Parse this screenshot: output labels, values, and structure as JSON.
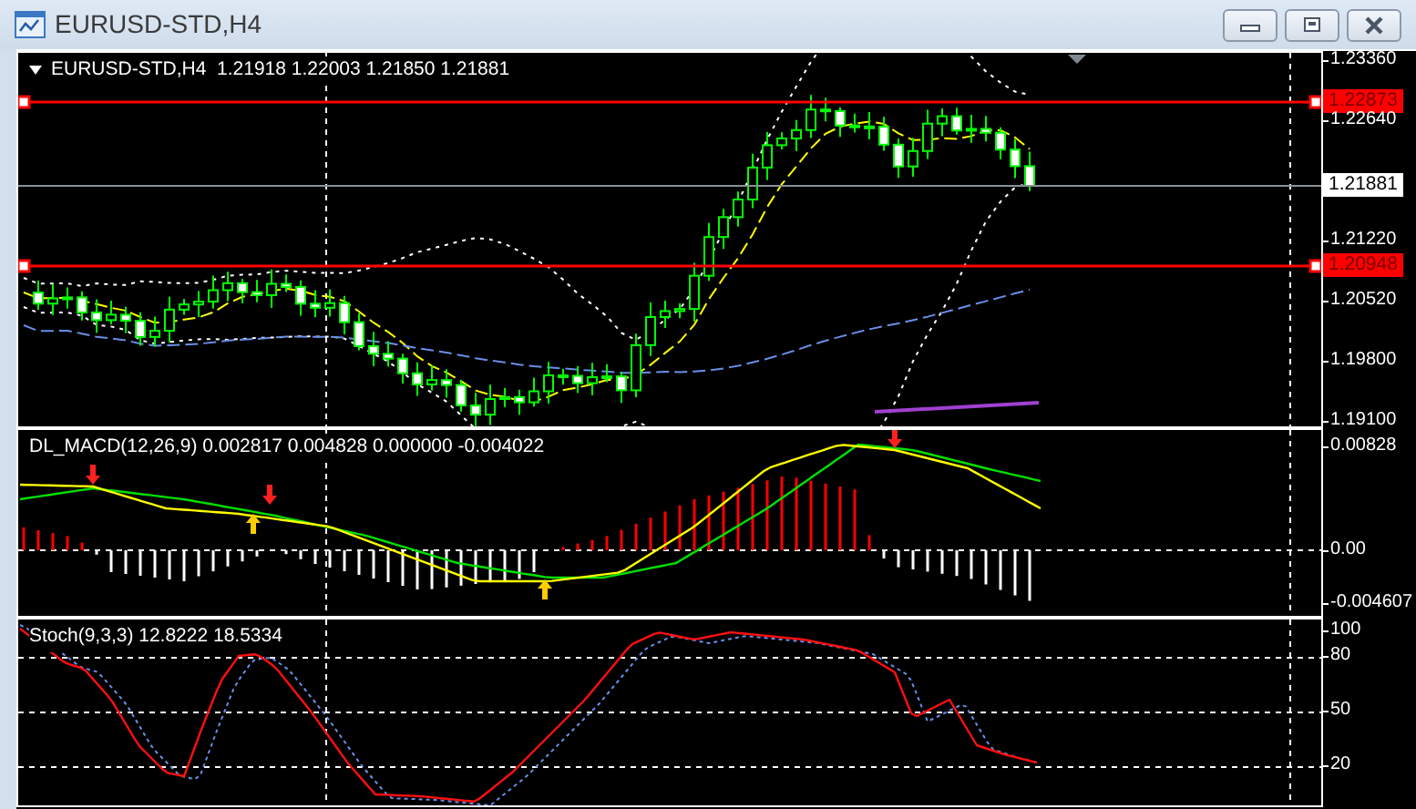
{
  "window": {
    "title": "EURUSD-STD,H4",
    "buttons": [
      {
        "kind": "minimize"
      },
      {
        "kind": "restore"
      },
      {
        "kind": "close"
      }
    ]
  },
  "price_pane": {
    "legend": "EURUSD-STD,H4  1.21918 1.22003 1.21850 1.21881",
    "axis_labels": [
      "1.23360",
      "1.22640",
      "1.21220",
      "1.20520",
      "1.19800",
      "1.19100"
    ],
    "lines": [
      {
        "kind": "level",
        "label": "1.22873"
      },
      {
        "kind": "bid",
        "label": "1.21881"
      },
      {
        "kind": "level",
        "label": "1.20948"
      }
    ]
  },
  "macd_pane": {
    "legend": "DL_MACD(12,26,9) 0.002817 0.004828 0.000000 -0.004022",
    "axis_labels": [
      "0.00828",
      "0.00",
      "-0.004607"
    ]
  },
  "stoch_pane": {
    "legend": "Stoch(9,3,3) 12.8222 18.5334",
    "axis_labels": [
      "100",
      "80",
      "50",
      "20"
    ]
  }
}
